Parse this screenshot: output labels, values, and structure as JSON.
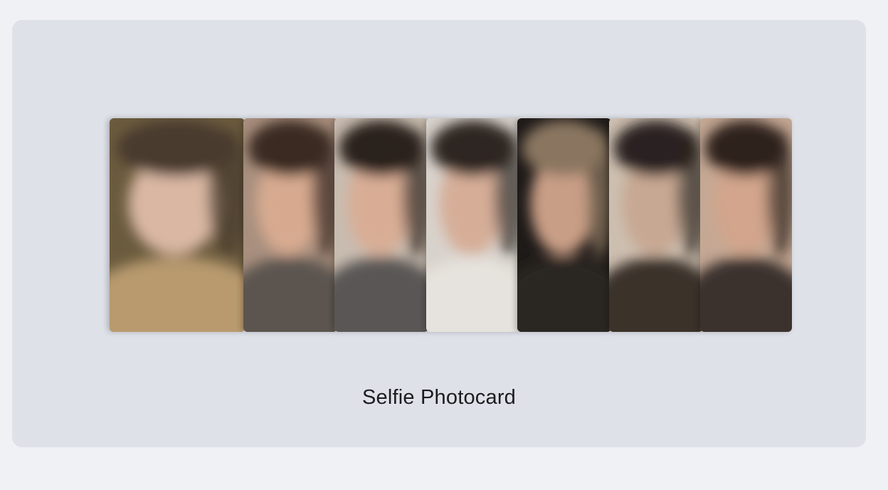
{
  "product": {
    "caption": "Selfie Photocard"
  },
  "cards": [
    {
      "name": "photocard-1",
      "bg": "#6b5b3e",
      "skin": "#d9b7a3",
      "hair": "#4a3a2e",
      "cloth": "#b89a6e"
    },
    {
      "name": "photocard-2",
      "bg": "#a88f7e",
      "skin": "#d7aa90",
      "hair": "#3a2a22",
      "cloth": "#5c5450"
    },
    {
      "name": "photocard-3",
      "bg": "#c8bcb0",
      "skin": "#d9ad95",
      "hair": "#2c221e",
      "cloth": "#5a5755"
    },
    {
      "name": "photocard-4",
      "bg": "#d8d2cc",
      "skin": "#d6ae98",
      "hair": "#2e2624",
      "cloth": "#e6e2dd"
    },
    {
      "name": "photocard-5",
      "bg": "#1e1a18",
      "skin": "#c99e86",
      "hair": "#8a7660",
      "cloth": "#2a2624"
    },
    {
      "name": "photocard-6",
      "bg": "#cdbfb0",
      "skin": "#c7a893",
      "hair": "#2a2420",
      "cloth": "#3a302c"
    },
    {
      "name": "photocard-7",
      "bg": "#c4a894",
      "skin": "#d2a58c",
      "hair": "#2d231f",
      "cloth": "#3a322e"
    }
  ]
}
